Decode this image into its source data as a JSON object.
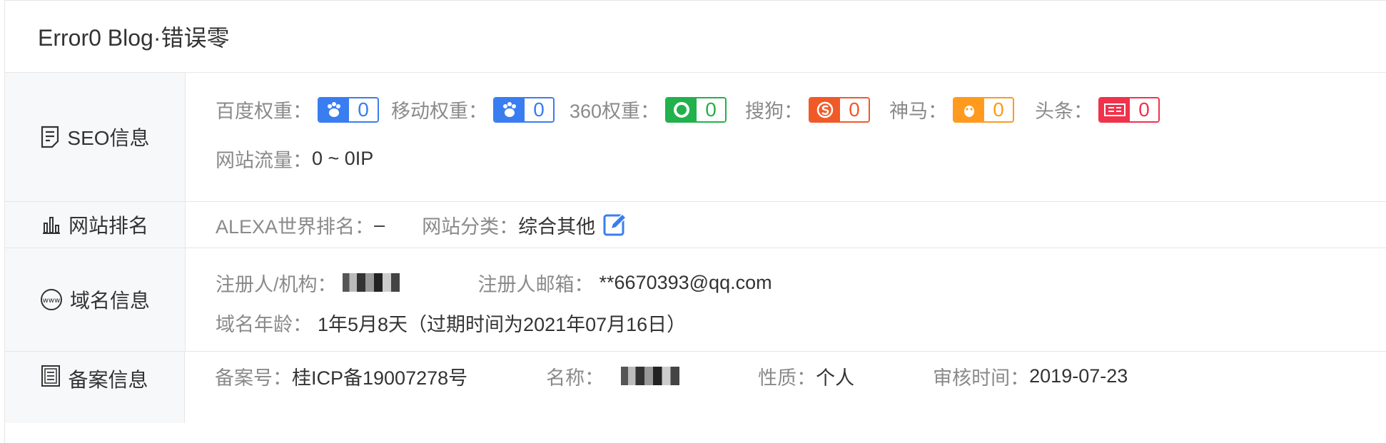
{
  "app_title": "Error0 Blog·错误零",
  "seo": {
    "head_label": "SEO信息",
    "items": [
      {
        "label": "百度权重：",
        "value": "0",
        "color": "#3a7df0",
        "icon": "baidu-paw-icon"
      },
      {
        "label": "移动权重：",
        "value": "0",
        "color": "#3a7df0",
        "icon": "baidu-mobile-icon"
      },
      {
        "label": "360权重：",
        "value": "0",
        "color": "#22b14c",
        "icon": "360-icon"
      },
      {
        "label": "搜狗：",
        "value": "0",
        "color": "#f05a28",
        "icon": "sogou-icon"
      },
      {
        "label": "神马：",
        "value": "0",
        "color": "#ff9a1e",
        "icon": "shenma-icon"
      },
      {
        "label": "头条：",
        "value": "0",
        "color": "#f0324b",
        "icon": "toutiao-icon"
      }
    ],
    "traffic_label": "网站流量：",
    "traffic_value": "0 ~ 0IP"
  },
  "rank": {
    "head_label": "网站排名",
    "alexa_label": "ALEXA世界排名：",
    "alexa_value": "–",
    "category_label": "网站分类：",
    "category_value": "综合其他"
  },
  "domain": {
    "head_label": "域名信息",
    "registrant_label": "注册人/机构：",
    "email_label": "注册人邮箱：",
    "email_value": "**6670393@qq.com",
    "age_label": "域名年龄：",
    "age_value": "1年5月8天（过期时间为2021年07月16日）"
  },
  "icp": {
    "head_label": "备案信息",
    "number_label": "备案号：",
    "number_value": "桂ICP备19007278号",
    "name_label": "名称：",
    "type_label": "性质：",
    "type_value": "个人",
    "audit_label": "审核时间：",
    "audit_value": "2019-07-23"
  }
}
